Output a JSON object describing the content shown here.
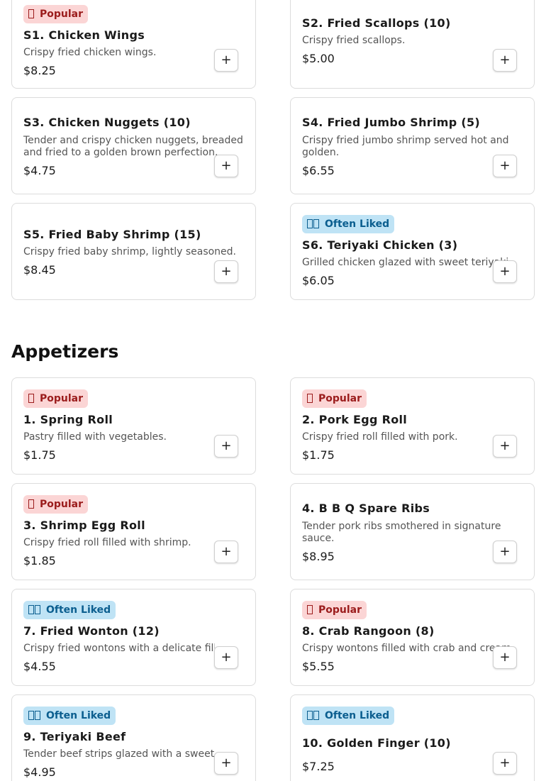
{
  "badges": {
    "popular": "Popular",
    "liked": "Often Liked"
  },
  "add_label": "+",
  "section_appetizers": "Appetizers",
  "items": [
    {
      "name": "S1. Chicken Wings",
      "desc": "Crispy fried chicken wings.",
      "price": "$8.25",
      "badge": "popular"
    },
    {
      "name": "S2. Fried Scallops (10)",
      "desc": "Crispy fried scallops.",
      "price": "$5.00",
      "badge": null
    },
    {
      "name": "S3. Chicken Nuggets (10)",
      "desc": "Tender and crispy chicken nuggets, breaded and fried to a golden brown perfection.",
      "price": "$4.75",
      "badge": null
    },
    {
      "name": "S4. Fried Jumbo Shrimp (5)",
      "desc": "Crispy fried jumbo shrimp served hot and golden.",
      "price": "$6.55",
      "badge": null
    },
    {
      "name": "S5. Fried Baby Shrimp (15)",
      "desc": "Crispy fried baby shrimp, lightly seasoned.",
      "price": "$8.45",
      "badge": null
    },
    {
      "name": "S6. Teriyaki Chicken (3)",
      "desc": "Grilled chicken glazed with sweet teriyaki.",
      "price": "$6.05",
      "badge": "liked"
    },
    {
      "name": "1. Spring Roll",
      "desc": "Pastry filled with vegetables.",
      "price": "$1.75",
      "badge": "popular"
    },
    {
      "name": "2. Pork Egg Roll",
      "desc": "Crispy fried roll filled with pork.",
      "price": "$1.75",
      "badge": "popular"
    },
    {
      "name": "3. Shrimp Egg Roll",
      "desc": "Crispy fried roll filled with shrimp.",
      "price": "$1.85",
      "badge": "popular"
    },
    {
      "name": "4. B B Q Spare Ribs",
      "desc": "Tender pork ribs smothered in signature sauce.",
      "price": "$8.95",
      "badge": null
    },
    {
      "name": "7. Fried Wonton (12)",
      "desc": "Crispy fried wontons with a delicate filling.",
      "price": "$4.55",
      "badge": "liked"
    },
    {
      "name": "8. Crab Rangoon (8)",
      "desc": "Crispy wontons filled with crab and cream.",
      "price": "$5.55",
      "badge": "popular"
    },
    {
      "name": "9. Teriyaki Beef",
      "desc": "Tender beef strips glazed with a sweet teriyaki.",
      "price": "$4.95",
      "badge": "liked"
    },
    {
      "name": "10. Golden Finger (10)",
      "desc": "",
      "price": "$7.25",
      "badge": "liked"
    }
  ]
}
